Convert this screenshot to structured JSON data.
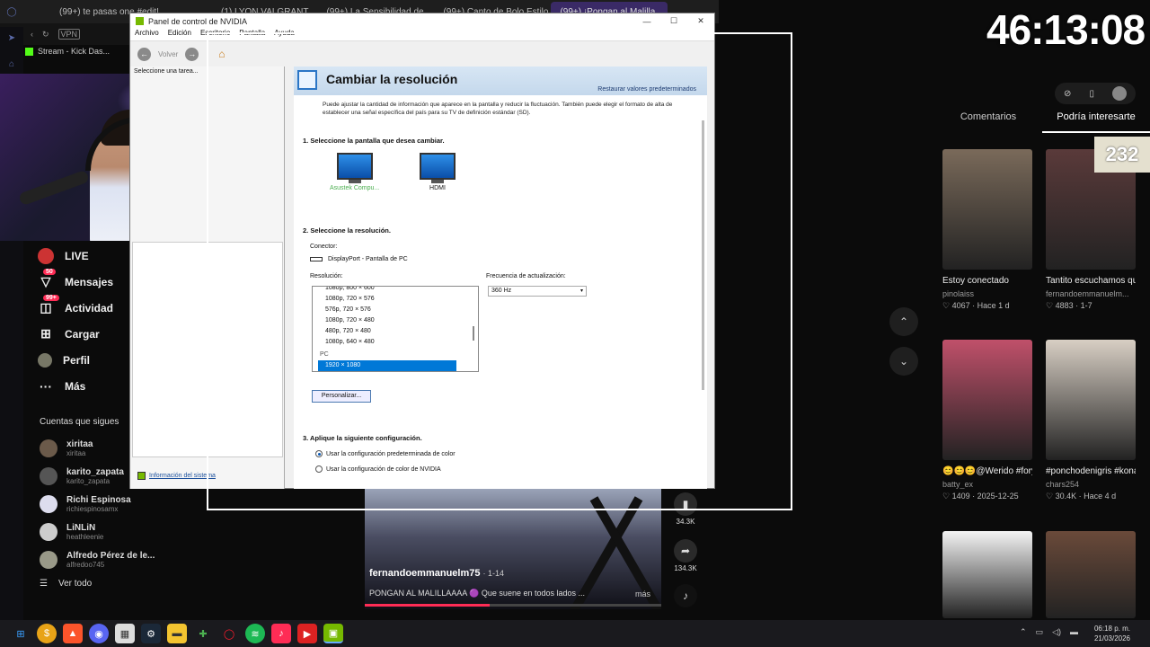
{
  "browser": {
    "tabs": [
      {
        "label": "(99+) te pasas one #edit!"
      },
      {
        "label": "(1) LYON VALGRANT"
      },
      {
        "label": "(99+) La Sensibilidad de..."
      },
      {
        "label": "(99+) Canto de Bolo Estilo"
      },
      {
        "label": "(99+) ¡Pongan al Malilla...",
        "active": true
      }
    ],
    "vpn_label": "VPN",
    "bookmark_label": "Stream - Kick Das..."
  },
  "sidebar": {
    "nav": [
      {
        "label": "LIVE",
        "icon": "live-icon"
      },
      {
        "label": "Mensajes",
        "icon": "messages-icon",
        "badge": "50"
      },
      {
        "label": "Actividad",
        "icon": "activity-icon",
        "badge": "99+"
      },
      {
        "label": "Cargar",
        "icon": "upload-icon"
      },
      {
        "label": "Perfil",
        "icon": "profile-icon"
      },
      {
        "label": "Más",
        "icon": "more-icon"
      }
    ],
    "following_title": "Cuentas que sigues",
    "accounts": [
      {
        "name": "xiritaa",
        "handle": "xiritaa"
      },
      {
        "name": "karito_zapata",
        "handle": "karito_zapata"
      },
      {
        "name": "Richi Espinosa",
        "handle": "richiespinosamx"
      },
      {
        "name": "LiNLiN",
        "handle": "heathleenie"
      },
      {
        "name": "Alfredo Pérez de le...",
        "handle": "alfredoo745"
      }
    ],
    "see_all": "Ver todo"
  },
  "nvidia": {
    "window_title": "Panel de control de NVIDIA",
    "menu": [
      "Archivo",
      "Edición",
      "Escritorio",
      "Pantalla",
      "Ayuda"
    ],
    "back_label": "Volver",
    "task_label": "Seleccione una tarea...",
    "sysinfo_label": "Información del sistema",
    "page_title": "Cambiar la resolución",
    "restore_label": "Restaurar valores predeterminados",
    "description": "Puede ajustar la cantidad de información que aparece en la pantalla y reducir la fluctuación. También puede elegir el formato de alta de establecer una señal específica del país para su TV de definición estándar (SD).",
    "step1": "1. Seleccione la pantalla que desea cambiar.",
    "monitors": [
      {
        "label": "Asustek Compu...",
        "selected": true
      },
      {
        "label": "HDMI",
        "selected": false
      }
    ],
    "step2": "2. Seleccione la resolución.",
    "connector_label": "Conector:",
    "connector_value": "DisplayPort - Pantalla de PC",
    "resolution_label": "Resolución:",
    "resolutions": [
      "1080p, 800 × 600",
      "1080p, 720 × 576",
      "576p, 720 × 576",
      "1080p, 720 × 480",
      "480p, 720 × 480",
      "1080p, 640 × 480"
    ],
    "pc_group": "PC",
    "selected_resolution": "1920 × 1080",
    "refresh_label": "Frecuencia de actualización:",
    "refresh_value": "360 Hz",
    "customize_button": "Personalizar...",
    "step3": "3. Aplique la siguiente configuración.",
    "color_options": [
      {
        "label": "Usar la configuración predeterminada de color",
        "checked": true
      },
      {
        "label": "Usar la configuración de color de NVIDIA",
        "checked": false
      }
    ]
  },
  "video": {
    "username": "fernandoemmanuelm75",
    "date": "· 1-14",
    "description": "PONGAN AL MALILLAAAA 🟣 Que suene en todos lados ...",
    "more": "más",
    "saves": "34.3K",
    "shares": "134.3K",
    "progress": 0.42
  },
  "stream": {
    "timer": "46:13:08",
    "viewer_count": "232"
  },
  "right_panel": {
    "tabs": [
      {
        "label": "Comentarios"
      },
      {
        "label": "Podría interesarte",
        "active": true
      }
    ],
    "cards": [
      {
        "title": "Estoy conectado",
        "user": "pinolaiss",
        "meta": "♡ 4067 · Hace 1 d",
        "color": "#7a6a5a"
      },
      {
        "title": "Tantito escuchamos que...",
        "user": "fernandoemmanuelm...",
        "meta": "♡ 4883 · 1-7",
        "color": "#5a3a3a"
      },
      {
        "title": "😊😊😊@Werido #foryou#fyp#rel...",
        "user": "batty_ex",
        "meta": "♡ 1409 · 2025-12-25",
        "color": "#c0506a"
      },
      {
        "title": "#ponchodenigris #konanbig",
        "user": "chars254",
        "meta": "♡ 30.4K · Hace 4 d",
        "color": "#d8cfc4"
      },
      {
        "title": "",
        "user": "",
        "meta": "",
        "color": "#f4f4f4"
      },
      {
        "title": "",
        "user": "",
        "meta": "",
        "color": "#6a4a3a"
      }
    ]
  },
  "taskbar": {
    "time": "06:18 p. m.",
    "date": "21/03/2026"
  }
}
